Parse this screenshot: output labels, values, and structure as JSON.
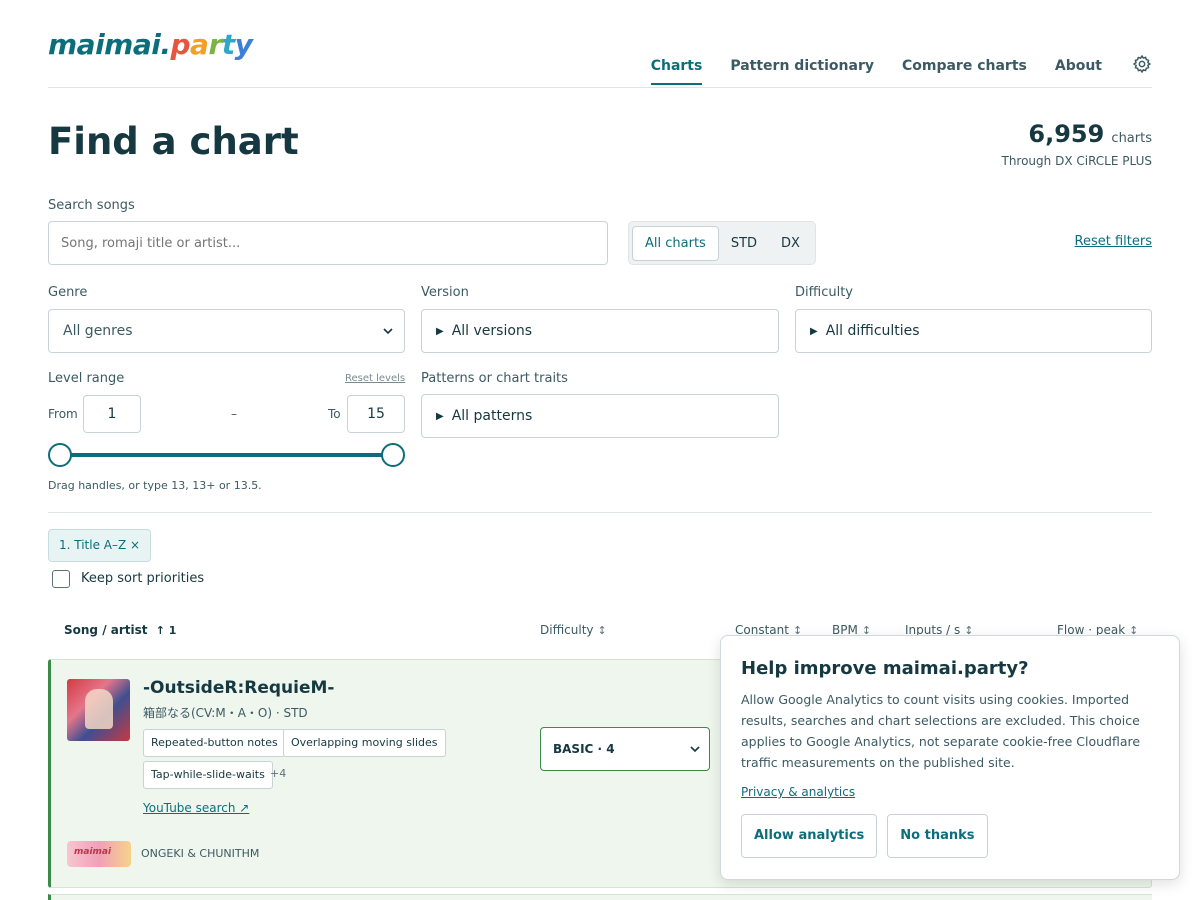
{
  "header": {
    "logo_a": "maimai.",
    "logo_p": [
      "p",
      "a",
      "r",
      "t",
      "y"
    ],
    "nav": [
      {
        "label": "Charts",
        "active": true
      },
      {
        "label": "Pattern dictionary",
        "active": false
      },
      {
        "label": "Compare charts",
        "active": false
      },
      {
        "label": "About",
        "active": false
      }
    ],
    "icon": "gear-icon"
  },
  "page": {
    "title": "Find a chart",
    "count": "6,959",
    "count_unit": "charts",
    "count_sub": "Through DX CiRCLE PLUS"
  },
  "filters": {
    "search_label": "Search songs",
    "search_placeholder": "Song, romaji title or artist...",
    "chart_types": [
      "All charts",
      "STD",
      "DX"
    ],
    "chart_type_selected": "All charts",
    "reset_filters": "Reset filters",
    "genre_label": "Genre",
    "genre_value": "All genres",
    "version_label": "Version",
    "version_value": "All versions",
    "difficulty_label": "Difficulty",
    "difficulty_value": "All difficulties",
    "level_label": "Level range",
    "reset_levels": "Reset levels",
    "from_label": "From",
    "from_value": "1",
    "dash": "–",
    "to_label": "To",
    "to_value": "15",
    "patterns_label": "Patterns or chart traits",
    "patterns_value": "All patterns",
    "hint": "Drag handles, or type 13, 13+ or 13.5."
  },
  "sort": {
    "chip": "1. Title A–Z ×",
    "keep_label": "Keep sort priorities"
  },
  "table": {
    "headers": {
      "song": "Song / artist",
      "song_sort": "↑ 1",
      "difficulty": "Difficulty",
      "constant": "Constant",
      "bpm": "BPM",
      "inputs": "Inputs / s",
      "flow": "Flow · peak"
    },
    "rows": [
      {
        "title": "-OutsideR:RequieM-",
        "subtitle": "箱部なる(CV:M・A・O) · STD",
        "tags": [
          "Repeated-button notes",
          "Overlapping moving slides",
          "Tap-while-slide-waits"
        ],
        "more": "+4",
        "youtube": "YouTube search ↗",
        "other": "ONGEKI & CHUNITHM",
        "difficulty": "BASIC · 4",
        "accent": "#3a8a4a"
      }
    ]
  },
  "consent": {
    "title": "Help improve maimai.party?",
    "body": "Allow Google Analytics to count visits using cookies. Imported results, searches and chart selections are excluded. This choice applies to Google Analytics, not separate cookie-free Cloudflare traffic measurements on the published site.",
    "link": "Privacy & analytics",
    "allow": "Allow analytics",
    "deny": "No thanks"
  },
  "colors": {
    "accent": "#0c6e7a",
    "basic_green": "#3a8a4a"
  }
}
